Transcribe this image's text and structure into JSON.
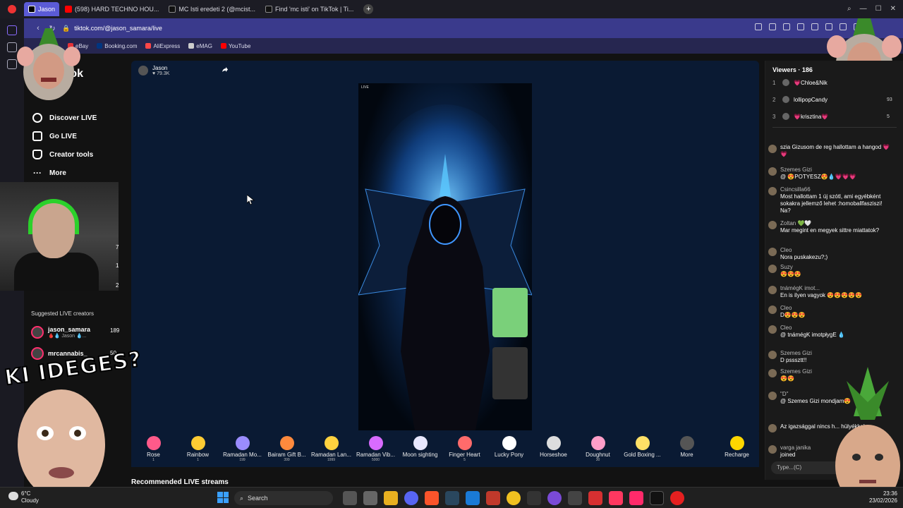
{
  "browser": {
    "tabs": [
      {
        "label": "Jason",
        "active": true,
        "color": "#5b5bd6"
      },
      {
        "label": "(598) HARD TECHNO HOU...",
        "active": false,
        "color": "#ff0000"
      },
      {
        "label": "MC Isti eredeti 2 (@mcist...",
        "active": false,
        "color": "#333333"
      },
      {
        "label": "Find 'mc isti' on TikTok | Ti...",
        "active": false,
        "color": "#333333"
      }
    ],
    "url": "tiktok.com/@jason_samara/live",
    "bookmarks": [
      "eBay",
      "Booking.com",
      "AliExpress",
      "eMAG",
      "YouTube"
    ]
  },
  "sidebar": {
    "logo_text": "tok",
    "items": [
      {
        "label": "Discover LIVE",
        "icon": "live-icon"
      },
      {
        "label": "Go LIVE",
        "icon": "camera-icon"
      },
      {
        "label": "Creator tools",
        "icon": "lightbulb-icon"
      },
      {
        "label": "More",
        "icon": "more-icon"
      }
    ],
    "suggested_header": "Suggested LIVE creators",
    "creators": [
      {
        "name": "jason_samara",
        "sub": "🩸💧 Jason 💧...",
        "count": "189"
      },
      {
        "name": "mrcannabis_",
        "sub": "",
        "count": "50"
      }
    ],
    "webcam_counts": [
      "7",
      "1",
      "2"
    ]
  },
  "overlay": {
    "kid_text": "KI IDEGES?"
  },
  "stream": {
    "host_name": "Jason",
    "host_likes": "79.3K",
    "live_tag": "LIVE",
    "cursor_icon": "pointer-icon"
  },
  "gifts": [
    {
      "label": "Rose",
      "price": "1",
      "color": "#ff5a8a"
    },
    {
      "label": "Rainbow",
      "price": "1",
      "color": "#ffcc33"
    },
    {
      "label": "Ramadan Mo...",
      "price": "199",
      "color": "#9a8cff"
    },
    {
      "label": "Bairam Gift B...",
      "price": "399",
      "color": "#ff8a3d"
    },
    {
      "label": "Ramadan Lan...",
      "price": "1999",
      "color": "#ffd23f"
    },
    {
      "label": "Ramadan Vib...",
      "price": "5000",
      "color": "#d86bff"
    },
    {
      "label": "Moon sighting",
      "price": "",
      "color": "#e8e8ff"
    },
    {
      "label": "Finger Heart",
      "price": "5",
      "color": "#ff6b6b"
    },
    {
      "label": "Lucky Pony",
      "price": "",
      "color": "#ffffff"
    },
    {
      "label": "Horseshoe",
      "price": "",
      "color": "#dddddd"
    },
    {
      "label": "Doughnut",
      "price": "30",
      "color": "#ff9ec8"
    },
    {
      "label": "Gold Boxing ...",
      "price": "",
      "color": "#ffe066"
    },
    {
      "label": "More",
      "price": "",
      "color": "#555555"
    },
    {
      "label": "Recharge",
      "price": "",
      "color": "#ffd700"
    }
  ],
  "recommended_label": "Recommended LIVE streams",
  "chat": {
    "viewers_label": "Viewers · 186",
    "top_viewers": [
      {
        "rank": "1",
        "name": "💗Chloe&Nik",
        "score": ""
      },
      {
        "rank": "2",
        "name": "lollipopCandy",
        "score": "93"
      },
      {
        "rank": "3",
        "name": "💗krisztina💗",
        "score": "5"
      }
    ],
    "messages": [
      {
        "user": "",
        "text": "szia Gizusom de reg hallottam a hangod 💗💗"
      },
      {
        "user": "Szemes Gizi",
        "text": "@ 😍POTYESZ😍💧💗💗💗"
      },
      {
        "user": "Csincsilla66",
        "text": "Most hallottam 1 új szótl, ami egyébként sokakra jellemző lehet :homoballfasziszi! Na?"
      },
      {
        "user": "Zoltan 💚🤍",
        "text": "Mar megint en megyek sittre miattatok?"
      },
      {
        "user": "Cleo",
        "text": "Nora puskakezu?;)"
      },
      {
        "user": "Suzy",
        "text": "😍😍😍"
      },
      {
        "user": "tnámégK imot...",
        "text": "En is ilyen vagyok 😍😍😍😍😍"
      },
      {
        "user": "Cleo",
        "text": "D😍😍😍"
      },
      {
        "user": "Cleo",
        "text": "@ tnámégK imotpłygE 💧"
      },
      {
        "user": "Szemes Gizi",
        "text": "D psssztt!!"
      },
      {
        "user": "Szemes Gizi",
        "text": "😍😍"
      },
      {
        "user": "\"D\"",
        "text": "@ Szemes Gizi mondjam😍"
      },
      {
        "user": "",
        "text": "Az igazsággal nincs h... hülyékkel"
      },
      {
        "user": "varga janika",
        "text": "joined"
      }
    ],
    "input_placeholder": "Type...(C)"
  },
  "taskbar": {
    "weather_temp": "6°C",
    "weather_label": "Cloudy",
    "search_label": "Search",
    "time": "23:36",
    "date": "23/02/2026"
  }
}
